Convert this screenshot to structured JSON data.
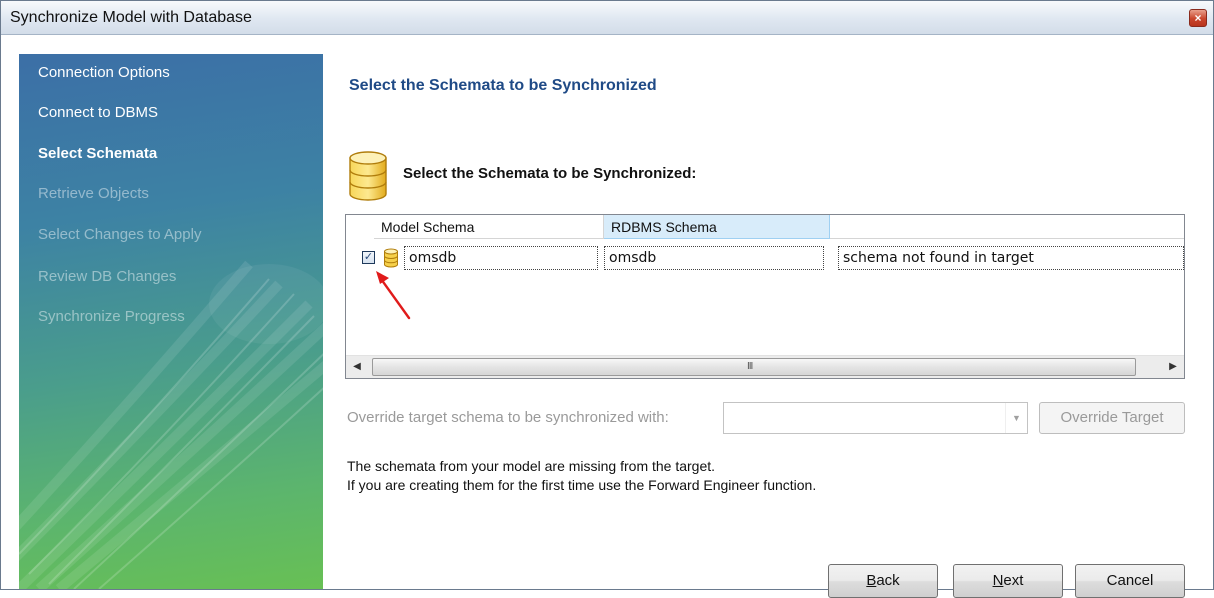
{
  "window": {
    "title": "Synchronize Model with Database",
    "close_label": "×"
  },
  "sidebar": {
    "items": [
      {
        "label": "Connection Options",
        "state": "done"
      },
      {
        "label": "Connect to DBMS",
        "state": "done"
      },
      {
        "label": "Select Schemata",
        "state": "active"
      },
      {
        "label": "Retrieve Objects",
        "state": "pending"
      },
      {
        "label": "Select Changes to Apply",
        "state": "pending"
      },
      {
        "label": "Review DB Changes",
        "state": "pending"
      },
      {
        "label": "Synchronize Progress",
        "state": "pending"
      }
    ]
  },
  "main": {
    "page_title": "Select the Schemata to be Synchronized",
    "section_title": "Select the Schemata to be Synchronized:",
    "table": {
      "columns": [
        "Model Schema",
        "RDBMS Schema"
      ],
      "rows": [
        {
          "checked": true,
          "check_glyph": "✓",
          "model_schema": "omsdb",
          "rdbms_schema": "omsdb",
          "status": "schema not found in target"
        }
      ],
      "scroll_left": "◀",
      "scroll_right": "▶",
      "scroll_grip": "III"
    },
    "override": {
      "label": "Override target schema to be synchronized with:",
      "combo_value": "",
      "caret": "▼",
      "button_label": "Override Target"
    },
    "message_lines": [
      "The schemata from your model are missing from the target.",
      "If you are creating them for the first time use the Forward Engineer function."
    ]
  },
  "footer": {
    "back": {
      "mnemonic": "B",
      "rest": "ack"
    },
    "next": {
      "mnemonic": "N",
      "rest": "ext"
    },
    "cancel_label": "Cancel"
  },
  "colors": {
    "title_accent": "#1f4a86",
    "sidebar_top": "#3c6fa6",
    "sidebar_bottom": "#68c054",
    "annotation_arrow": "#e01b1b",
    "db_icon": "#f2c230"
  },
  "icons": {
    "section_icon": "database-icon",
    "row_icon": "database-icon",
    "annotation": "red-arrow-icon"
  }
}
